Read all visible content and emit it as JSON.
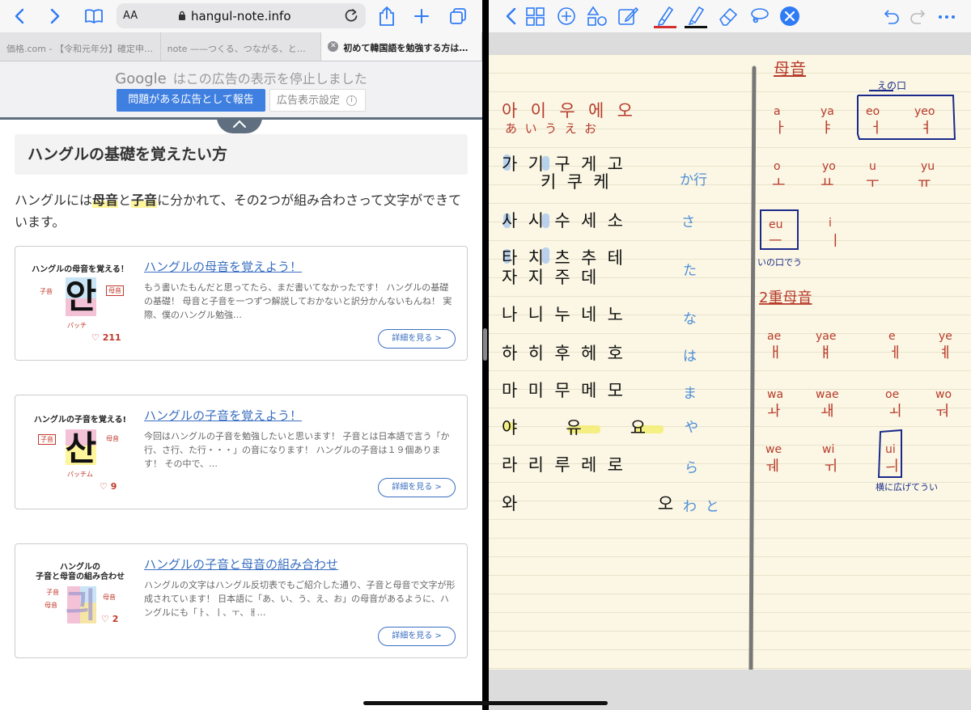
{
  "safari": {
    "url": "hangul-note.info",
    "text_size_label": "AA",
    "tabs": [
      {
        "title": "価格.com - 【令和元年分】確定申告…"
      },
      {
        "title": "note ——つくる、つながる、とど…"
      },
      {
        "title": "初めて韓国語を勉強する方は「こ…"
      }
    ]
  },
  "ad": {
    "brand": "Google",
    "message": "はこの広告の表示を停止しました",
    "report_button": "問題がある広告として報告",
    "settings_button": "広告表示設定",
    "info_glyph": "i"
  },
  "article": {
    "section_heading": "ハングルの基礎を覚えたい方",
    "intro": {
      "p1": "ハングルには",
      "h1": "母音",
      "p2": "と",
      "h2": "子音",
      "p3": "に分かれて、その2つが組み合わさって文字ができています。"
    },
    "more_label": "詳細を見る >",
    "cards": [
      {
        "title": "ハングルの母音を覚えよう！",
        "desc": "もう書いたもんだと思ってたら、まだ書いてなかったです！ ハングルの基礎の基礎！ 母音と子音を一つずつ解説しておかないと訳分かんないもんね！ 実際、僕のハングル勉強…",
        "thumb_caption": "ハングルの母音を覚える！",
        "thumb_char": "안",
        "thumb_labels": [
          "子音",
          "母音",
          "パッチ"
        ],
        "likes": "♡ 211"
      },
      {
        "title": "ハングルの子音を覚えよう！",
        "desc": "今回はハングルの子音を勉強したいと思います！ 子音とは日本語で言う「か行、さ行、た行・・・」の音になります！ ハングルの子音は１９個あります！ その中で、…",
        "thumb_caption": "ハングルの子音を覚える!",
        "thumb_char": "산",
        "thumb_labels": [
          "子音",
          "母音",
          "パッチム"
        ],
        "likes": "♡ 9"
      },
      {
        "title": "ハングルの子音と母音の組み合わせ",
        "desc": "ハングルの文字はハングル反切表でもご紹介した通り、子音と母音で文字が形成されています！ 日本語に「あ、い、う、え、お」の母音があるように、ハングルにも「ㅏ、ㅣ、ㅜ、ㅐ…",
        "thumb_caption_1": "ハングルの",
        "thumb_caption_2": "子音と母音の組み合わせ",
        "thumb_char": "긔",
        "thumb_labels": [
          "子音",
          "母音",
          "母音"
        ],
        "likes": "♡ 2"
      }
    ]
  },
  "notebook": {
    "colors": {
      "red": "#b83a2b",
      "black": "#111111",
      "blue": "#2f7bd6",
      "navy": "#1a2a8a",
      "highlight_blue": "#a9c8ee",
      "highlight_yellow": "#f4ee6a"
    },
    "left_rows": [
      {
        "hangul": "아  이  우  에  오",
        "kana": "あ  い  う  え  お"
      },
      {
        "hangul": "가  기  구  게  고",
        "hangul2": "키  쿠  케",
        "kana_row": "か行"
      },
      {
        "hangul": "사  시  수  세  소",
        "kana_row": "さ"
      },
      {
        "hangul": "타  치  츠  추  테",
        "hangul2": "자  지  주  데",
        "kana_row": "た"
      },
      {
        "hangul": "나  니  누  네  노",
        "kana_row": "な"
      },
      {
        "hangul": "하  히  후  헤  호",
        "kana_row": "は"
      },
      {
        "hangul": "마  미  무  메  모",
        "kana_row": "ま"
      },
      {
        "hangul": "야         유         요",
        "kana_row": "や"
      },
      {
        "hangul": "라  리  루  레  로",
        "kana_row": "ら"
      },
      {
        "hangul": "와                          오",
        "kana_row": "わ  と"
      }
    ],
    "vowels_heading": "母音",
    "vowel_rows": [
      [
        {
          "r": "a",
          "h": "ㅏ"
        },
        {
          "r": "ya",
          "h": "ㅑ"
        },
        {
          "r": "eo",
          "h": "ㅓ"
        },
        {
          "r": "yeo",
          "h": "ㅕ"
        }
      ],
      [
        {
          "r": "o",
          "h": "ㅗ"
        },
        {
          "r": "yo",
          "h": "ㅛ"
        },
        {
          "r": "u",
          "h": "ㅜ"
        },
        {
          "r": "yu",
          "h": "ㅠ"
        }
      ]
    ],
    "eo_note": "えの口",
    "eu": {
      "r": "eu",
      "h": "ㅡ",
      "note": "いの口でう"
    },
    "i": {
      "r": "i",
      "h": "ㅣ"
    },
    "double_heading": "2重母音",
    "double_rows": [
      [
        {
          "r": "ae",
          "h": "ㅐ"
        },
        {
          "r": "yae",
          "h": "ㅒ"
        },
        {
          "r": "e",
          "h": "ㅔ"
        },
        {
          "r": "ye",
          "h": "ㅖ"
        }
      ],
      [
        {
          "r": "wa",
          "h": "ㅘ"
        },
        {
          "r": "wae",
          "h": "ㅙ"
        },
        {
          "r": "oe",
          "h": "ㅚ"
        },
        {
          "r": "wo",
          "h": "ㅝ"
        }
      ],
      [
        {
          "r": "we",
          "h": "ㅞ"
        },
        {
          "r": "wi",
          "h": "ㅟ"
        },
        {
          "r": "ui",
          "h": "ㅢ"
        }
      ]
    ],
    "ui_note": "横に広げてうい"
  }
}
